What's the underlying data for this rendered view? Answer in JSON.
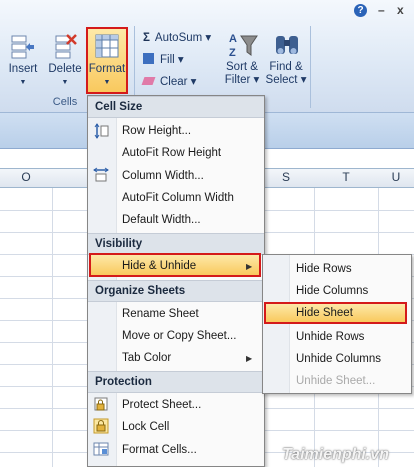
{
  "ribbon": {
    "buttons": {
      "insert": "Insert",
      "delete": "Delete",
      "format": "Format"
    },
    "group_cells": "Cells",
    "editing": {
      "autosum": "AutoSum ▾",
      "fill": "Fill ▾",
      "clear": "Clear ▾",
      "sort_filter_1": "Sort &",
      "sort_filter_2": "Filter ▾",
      "find_select_1": "Find &",
      "find_select_2": "Select ▾"
    },
    "window_controls": {
      "min": "–",
      "close": "x"
    },
    "help": "?"
  },
  "columns": [
    "O",
    "S",
    "T",
    "U"
  ],
  "menu": {
    "cell_size": "Cell Size",
    "row_height": "Row Height...",
    "autofit_row": "AutoFit Row Height",
    "column_width": "Column Width...",
    "autofit_column": "AutoFit Column Width",
    "default_width": "Default Width...",
    "visibility": "Visibility",
    "hide_unhide": "Hide & Unhide",
    "organize": "Organize Sheets",
    "rename": "Rename Sheet",
    "move_copy": "Move or Copy Sheet...",
    "tab_color": "Tab Color",
    "protection": "Protection",
    "protect_sheet": "Protect Sheet...",
    "lock_cell": "Lock Cell",
    "format_cells": "Format Cells..."
  },
  "submenu": {
    "hide_rows": "Hide Rows",
    "hide_columns": "Hide Columns",
    "hide_sheet": "Hide Sheet",
    "unhide_rows": "Unhide Rows",
    "unhide_columns": "Unhide Columns",
    "unhide_sheet": "Unhide Sheet..."
  },
  "watermark": "Taimienphi.vn",
  "colors": {
    "highlight_border": "#d41a1a",
    "highlight_fill": "#f9c95e",
    "ribbon_text": "#1f3a66"
  }
}
